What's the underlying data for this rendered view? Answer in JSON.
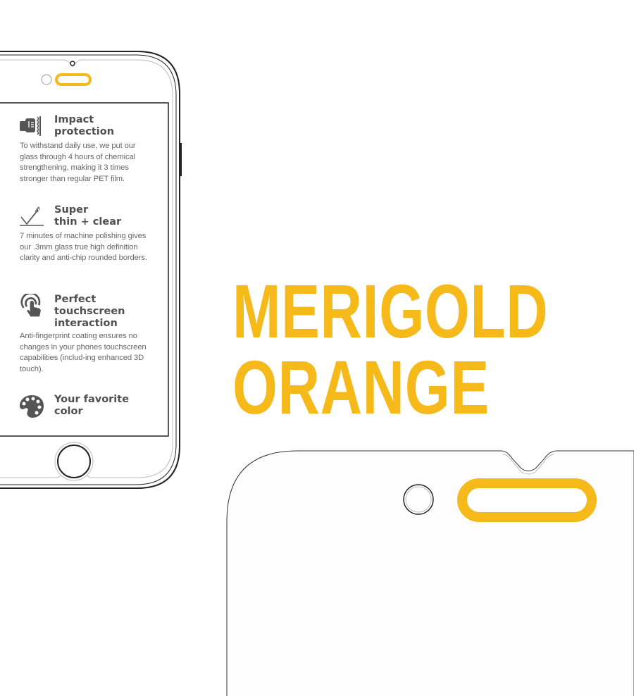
{
  "features": [
    {
      "icon": "fist-impact-icon",
      "title_lines": [
        "Impact",
        "protection"
      ],
      "desc": "To withstand daily use, we put our glass through 4 hours of chemical strengthening, making it 3 times stronger than regular PET film."
    },
    {
      "icon": "thin-clear-icon",
      "title_lines": [
        "Super",
        "thin + clear"
      ],
      "desc": "7 minutes of machine polishing gives our .3mm glass true high definition clarity and anti-chip rounded borders."
    },
    {
      "icon": "touch-icon",
      "title_lines": [
        "Perfect",
        "touchscreen",
        "interaction"
      ],
      "desc": "Anti-fingerprint coating ensures no changes in your phones touchscreen capabilities (includ-ing enhanced 3D touch)."
    },
    {
      "icon": "palette-icon",
      "title_lines": [
        "Your favorite",
        "color"
      ],
      "desc": ""
    }
  ],
  "headline": {
    "line1": "MERIGOLD",
    "line2": "ORANGE"
  },
  "colors": {
    "accent": "#F6B91A",
    "outline": "#222222",
    "text": "#555555"
  }
}
